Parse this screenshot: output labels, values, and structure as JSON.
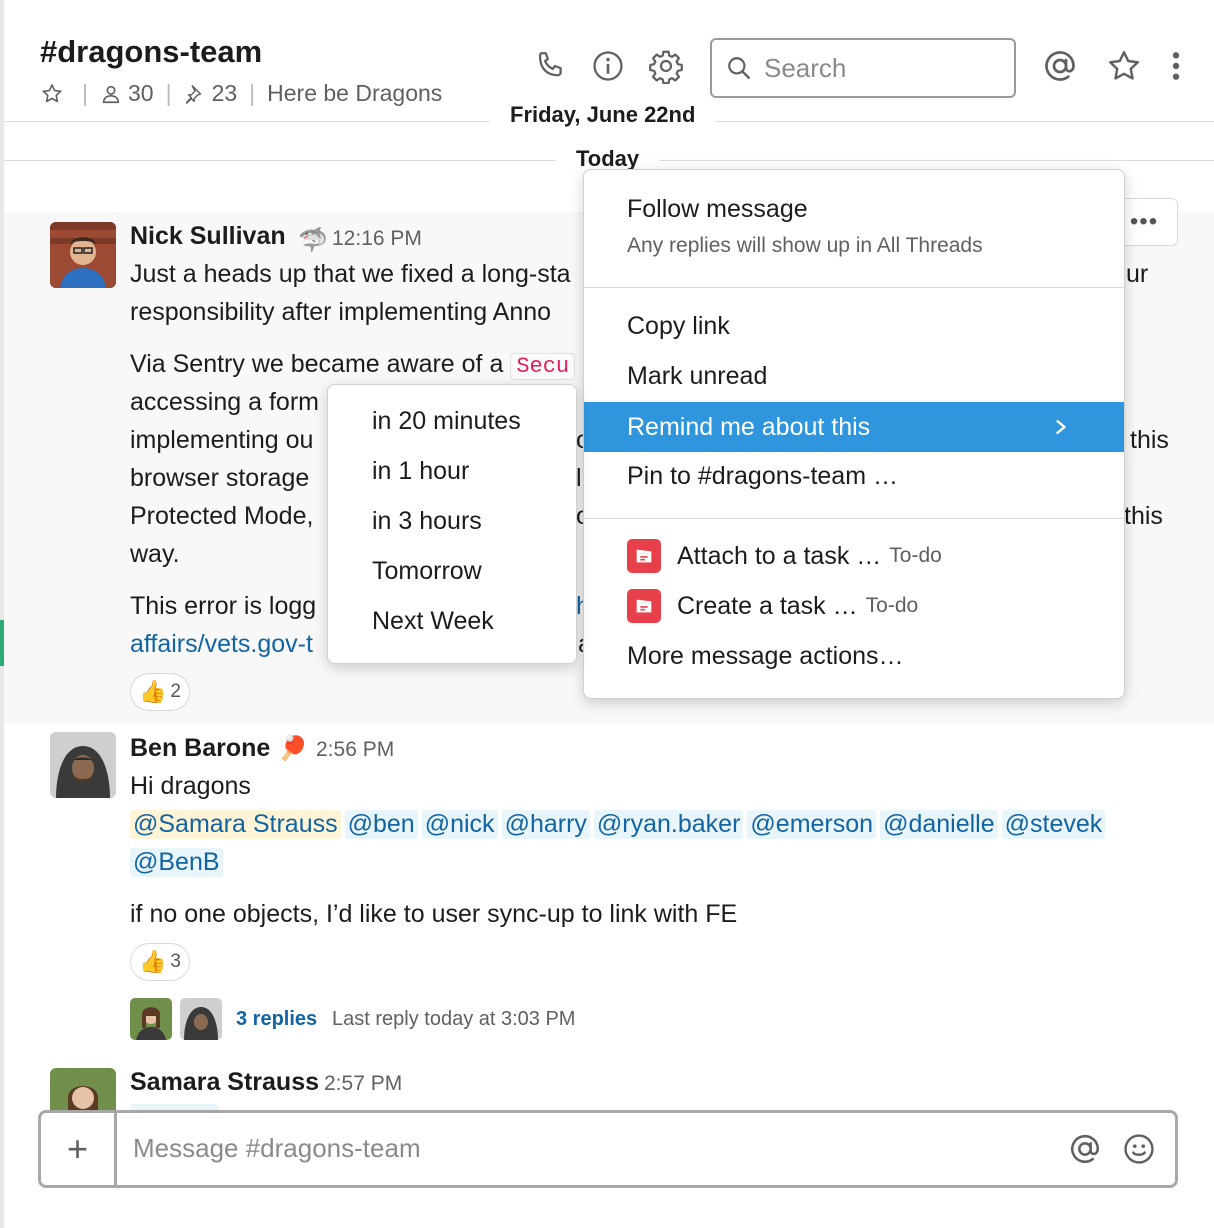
{
  "header": {
    "channel_title": "#dragons-team",
    "members_count": "30",
    "pins_count": "23",
    "topic": "Here be Dragons",
    "search_placeholder": "Search"
  },
  "dividers": {
    "previous_day": "Friday, June 22nd",
    "today": "Today"
  },
  "messages": [
    {
      "author": "Nick Sullivan",
      "time": "12:16 PM",
      "line1": "Just a heads up that we fixed a long-sta",
      "line1_end": "ur",
      "line2": "responsibility after implementing Anno",
      "line3_start": "Via Sentry we became aware of a ",
      "code_tag": "Secu",
      "line4": "accessing a form",
      "line5": "implementing ou",
      "line5_mid": "o",
      "line5_end": "this",
      "line6": "browser storage",
      "line6_mid": "l",
      "line7": "Protected Mode,",
      "line7_mid": "o",
      "line7_end": "this",
      "line8": "way.",
      "line9": "This error is logg",
      "line9_mid": "h",
      "line10": "affairs/vets.gov-t",
      "line10_mid": "a",
      "reaction_count": "2"
    },
    {
      "author": "Ben Barone",
      "time": "2:56 PM",
      "line1": "Hi dragons",
      "mentions": [
        "@Samara Strauss",
        "@ben",
        "@nick",
        "@harry",
        "@ryan.baker",
        "@emerson",
        "@danielle",
        "@stevek"
      ],
      "mention_line2": "@BenB",
      "line3": "if no one objects, I’d like to user sync-up to link with FE",
      "reaction_count": "3",
      "replies": "3 replies",
      "last_reply": "Last reply today at 3:03 PM"
    },
    {
      "author": "Samara Strauss",
      "time": "2:57 PM"
    }
  ],
  "context_menu": {
    "follow": "Follow message",
    "follow_sub": "Any replies will show up in All Threads",
    "copy_link": "Copy link",
    "mark_unread": "Mark unread",
    "remind": "Remind me about this",
    "pin": "Pin to #dragons-team …",
    "attach_task": "Attach to a task …",
    "create_task": "Create a task …",
    "todo_tag": "To-do",
    "more_actions": "More message actions…"
  },
  "remind_submenu": [
    "in 20 minutes",
    "in 1 hour",
    "in 3 hours",
    "Tomorrow",
    "Next Week"
  ],
  "composer": {
    "placeholder": "Message #dragons-team"
  },
  "colors": {
    "accent": "#2f95dc",
    "link": "#1264a3",
    "todo_red": "#e8404a"
  },
  "icons": [
    "star-icon",
    "member-icon",
    "pin-icon",
    "phone-icon",
    "info-icon",
    "gear-icon",
    "search-icon",
    "at-icon",
    "star-icon",
    "kebab-icon",
    "plus-icon",
    "emoji-icon",
    "thumbs-up-icon",
    "chevron-right-icon",
    "todo-icon",
    "shark-emoji",
    "pingpong-emoji"
  ]
}
